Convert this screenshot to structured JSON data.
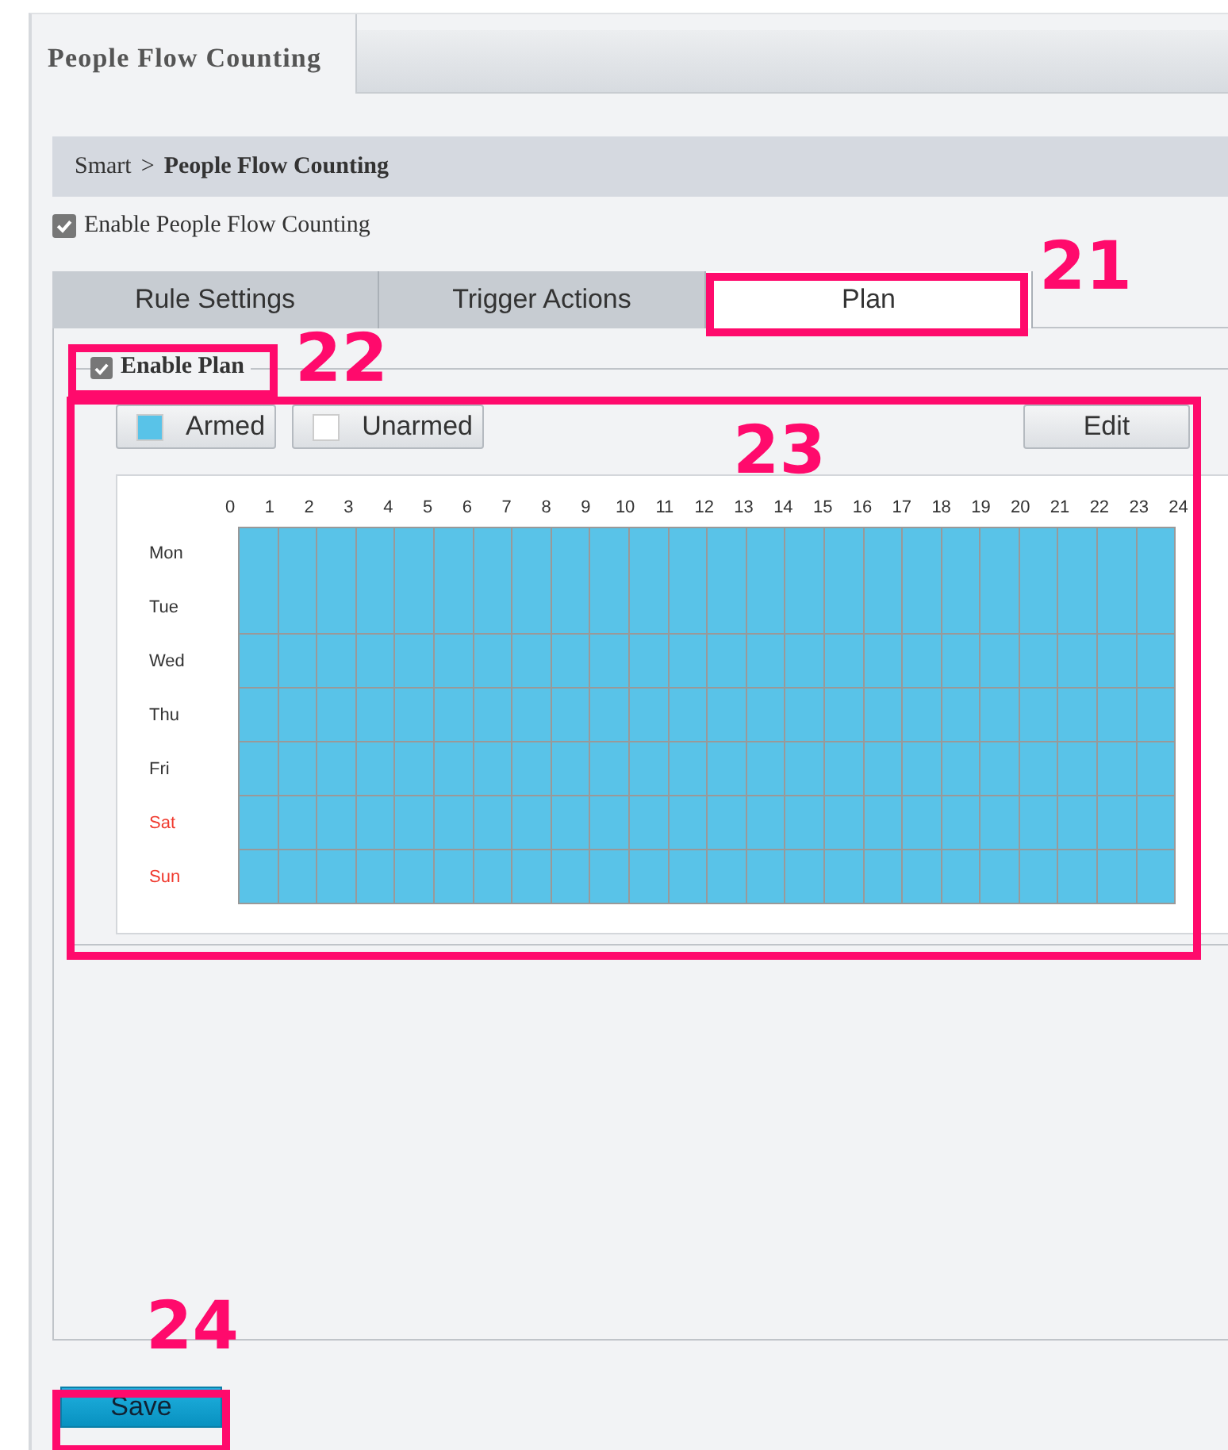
{
  "page_tab": {
    "label": "People Flow Counting",
    "selected": true
  },
  "breadcrumb": {
    "parent": "Smart",
    "separator": ">",
    "current": "People Flow Counting"
  },
  "enable_counting": {
    "label": "Enable People Flow Counting",
    "checked": true
  },
  "tabs": [
    {
      "label": "Rule Settings",
      "selected": false
    },
    {
      "label": "Trigger Actions",
      "selected": false
    },
    {
      "label": "Plan",
      "selected": true
    }
  ],
  "enable_plan": {
    "label": "Enable Plan",
    "checked": true
  },
  "legend": [
    {
      "label": "Armed",
      "color": "#59c3e8"
    },
    {
      "label": "Unarmed",
      "color": "#ffffff"
    }
  ],
  "edit_button": "Edit",
  "hours": [
    "0",
    "1",
    "2",
    "3",
    "4",
    "5",
    "6",
    "7",
    "8",
    "9",
    "10",
    "11",
    "12",
    "13",
    "14",
    "15",
    "16",
    "17",
    "18",
    "19",
    "20",
    "21",
    "22",
    "23",
    "24"
  ],
  "schedule": [
    {
      "day": "Mon",
      "weekend": false,
      "armed": [
        true,
        true,
        true,
        true,
        true,
        true,
        true,
        true,
        true,
        true,
        true,
        true,
        true,
        true,
        true,
        true,
        true,
        true,
        true,
        true,
        true,
        true,
        true,
        true
      ]
    },
    {
      "day": "Tue",
      "weekend": false,
      "armed": [
        true,
        true,
        true,
        true,
        true,
        true,
        true,
        true,
        true,
        true,
        true,
        true,
        true,
        true,
        true,
        true,
        true,
        true,
        true,
        true,
        true,
        true,
        true,
        true
      ]
    },
    {
      "day": "Wed",
      "weekend": false,
      "armed": [
        true,
        true,
        true,
        true,
        true,
        true,
        true,
        true,
        true,
        true,
        true,
        true,
        true,
        true,
        true,
        true,
        true,
        true,
        true,
        true,
        true,
        true,
        true,
        true
      ]
    },
    {
      "day": "Thu",
      "weekend": false,
      "armed": [
        true,
        true,
        true,
        true,
        true,
        true,
        true,
        true,
        true,
        true,
        true,
        true,
        true,
        true,
        true,
        true,
        true,
        true,
        true,
        true,
        true,
        true,
        true,
        true
      ]
    },
    {
      "day": "Fri",
      "weekend": false,
      "armed": [
        true,
        true,
        true,
        true,
        true,
        true,
        true,
        true,
        true,
        true,
        true,
        true,
        true,
        true,
        true,
        true,
        true,
        true,
        true,
        true,
        true,
        true,
        true,
        true
      ]
    },
    {
      "day": "Sat",
      "weekend": true,
      "armed": [
        true,
        true,
        true,
        true,
        true,
        true,
        true,
        true,
        true,
        true,
        true,
        true,
        true,
        true,
        true,
        true,
        true,
        true,
        true,
        true,
        true,
        true,
        true,
        true
      ]
    },
    {
      "day": "Sun",
      "weekend": true,
      "armed": [
        true,
        true,
        true,
        true,
        true,
        true,
        true,
        true,
        true,
        true,
        true,
        true,
        true,
        true,
        true,
        true,
        true,
        true,
        true,
        true,
        true,
        true,
        true,
        true
      ]
    }
  ],
  "save_button": "Save",
  "callouts": [
    {
      "label": "21"
    },
    {
      "label": "22"
    },
    {
      "label": "23"
    },
    {
      "label": "24"
    }
  ]
}
